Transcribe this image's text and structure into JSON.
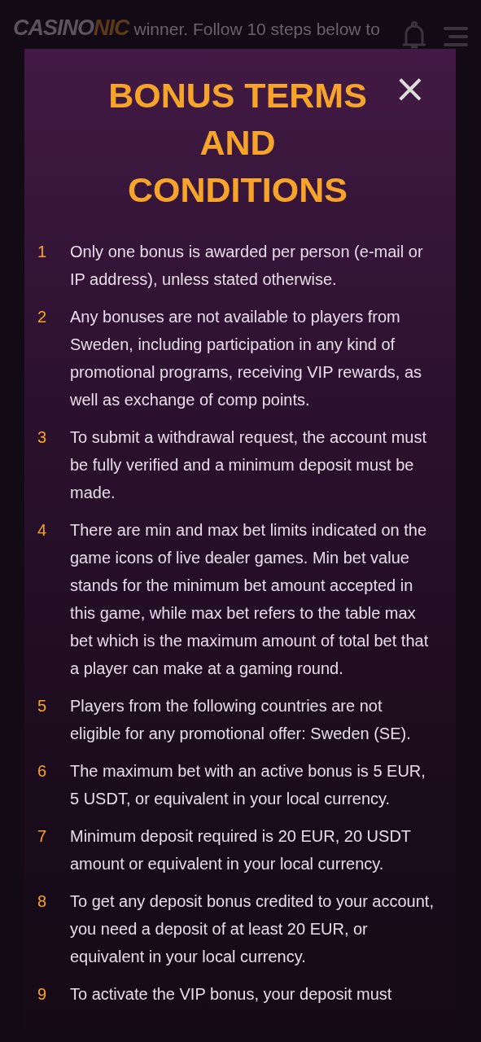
{
  "header": {
    "logo_main": "CASINO",
    "logo_accent": "NIC",
    "background_text": "winner. Follow 10 steps below to"
  },
  "modal": {
    "title": "BONUS TERMS AND CONDITIONS",
    "close": "×",
    "terms": [
      {
        "number": "1",
        "text": "Only one bonus is awarded per person (e-mail or IP address), unless stated otherwise."
      },
      {
        "number": "2",
        "text": "Any bonuses are not available to players from Sweden, including participation in any kind of promotional programs, receiving VIP rewards, as well as exchange of comp points."
      },
      {
        "number": "3",
        "text": "To submit a withdrawal request, the account must be fully verified and a minimum deposit must be made."
      },
      {
        "number": "4",
        "text": "There are min and max bet limits indicated on the game icons of live dealer games. Min bet value stands for the minimum bet amount accepted in this game, while max bet refers to the table max bet which is the maximum amount of total bet that a player can make at a gaming round."
      },
      {
        "number": "5",
        "text": "Players from the following countries are not eligible for any promotional offer: Sweden (SE)."
      },
      {
        "number": "6",
        "text": "The maximum bet with an active bonus is 5 EUR, 5 USDT, or equivalent in your local currency."
      },
      {
        "number": "7",
        "text": "Minimum deposit required is 20 EUR, 20 USDT amount or equivalent in your local currency."
      },
      {
        "number": "8",
        "text": "To get any deposit bonus credited to your account, you need a deposit of at least 20 EUR, or equivalent in your local currency."
      },
      {
        "number": "9",
        "text": "To activate the VIP bonus, your deposit must"
      }
    ]
  }
}
